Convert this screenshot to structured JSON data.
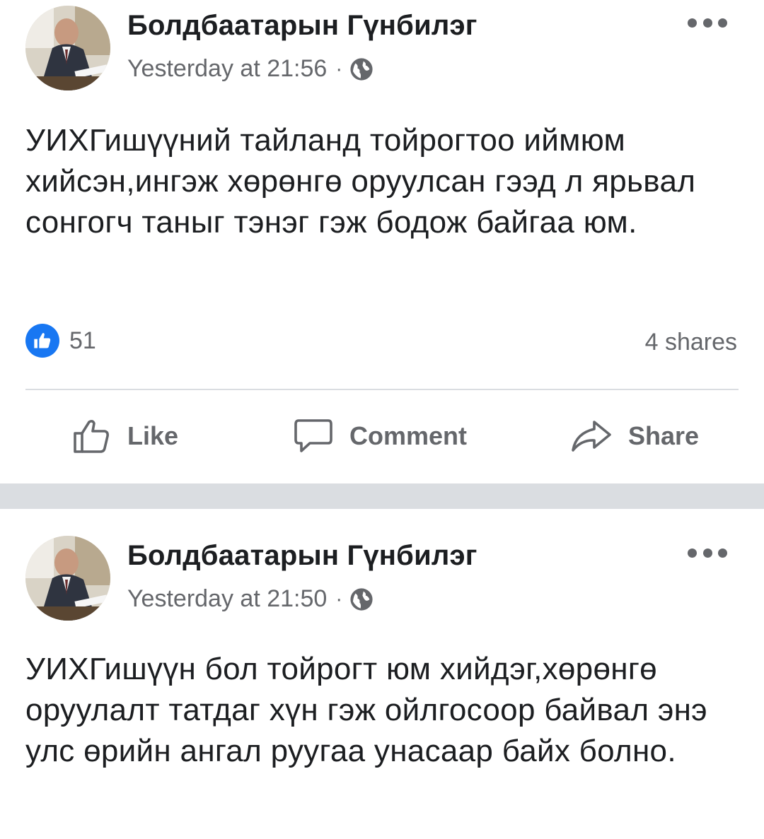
{
  "posts": [
    {
      "author": "Болдбаатарын Гүнбилэг",
      "timestamp": "Yesterday at 21:56",
      "separator": "·",
      "audience_icon": "globe-icon",
      "text": "УИХГишүүний тайланд тойрогтоо иймюм хийсэн,ингэж хөрөнгө оруулсан гээд л ярьвал сонгогч таныг тэнэг гэж бодож байгаа юм.",
      "like_count": "51",
      "shares": "4 shares",
      "actions": {
        "like": "Like",
        "comment": "Comment",
        "share": "Share"
      }
    },
    {
      "author": "Болдбаатарын Гүнбилэг",
      "timestamp": "Yesterday at 21:50",
      "separator": "·",
      "audience_icon": "globe-icon",
      "text": "УИХГишүүн бол тойрогт юм хийдэг,хөрөнгө оруулалт татдаг хүн гэж ойлгосоор байвал энэ улс өрийн ангал руугаа унасаар байх болно."
    }
  ],
  "colors": {
    "text": "#1c1e21",
    "secondary": "#65676b",
    "accent": "#1877f2",
    "divider": "#dadde1"
  }
}
